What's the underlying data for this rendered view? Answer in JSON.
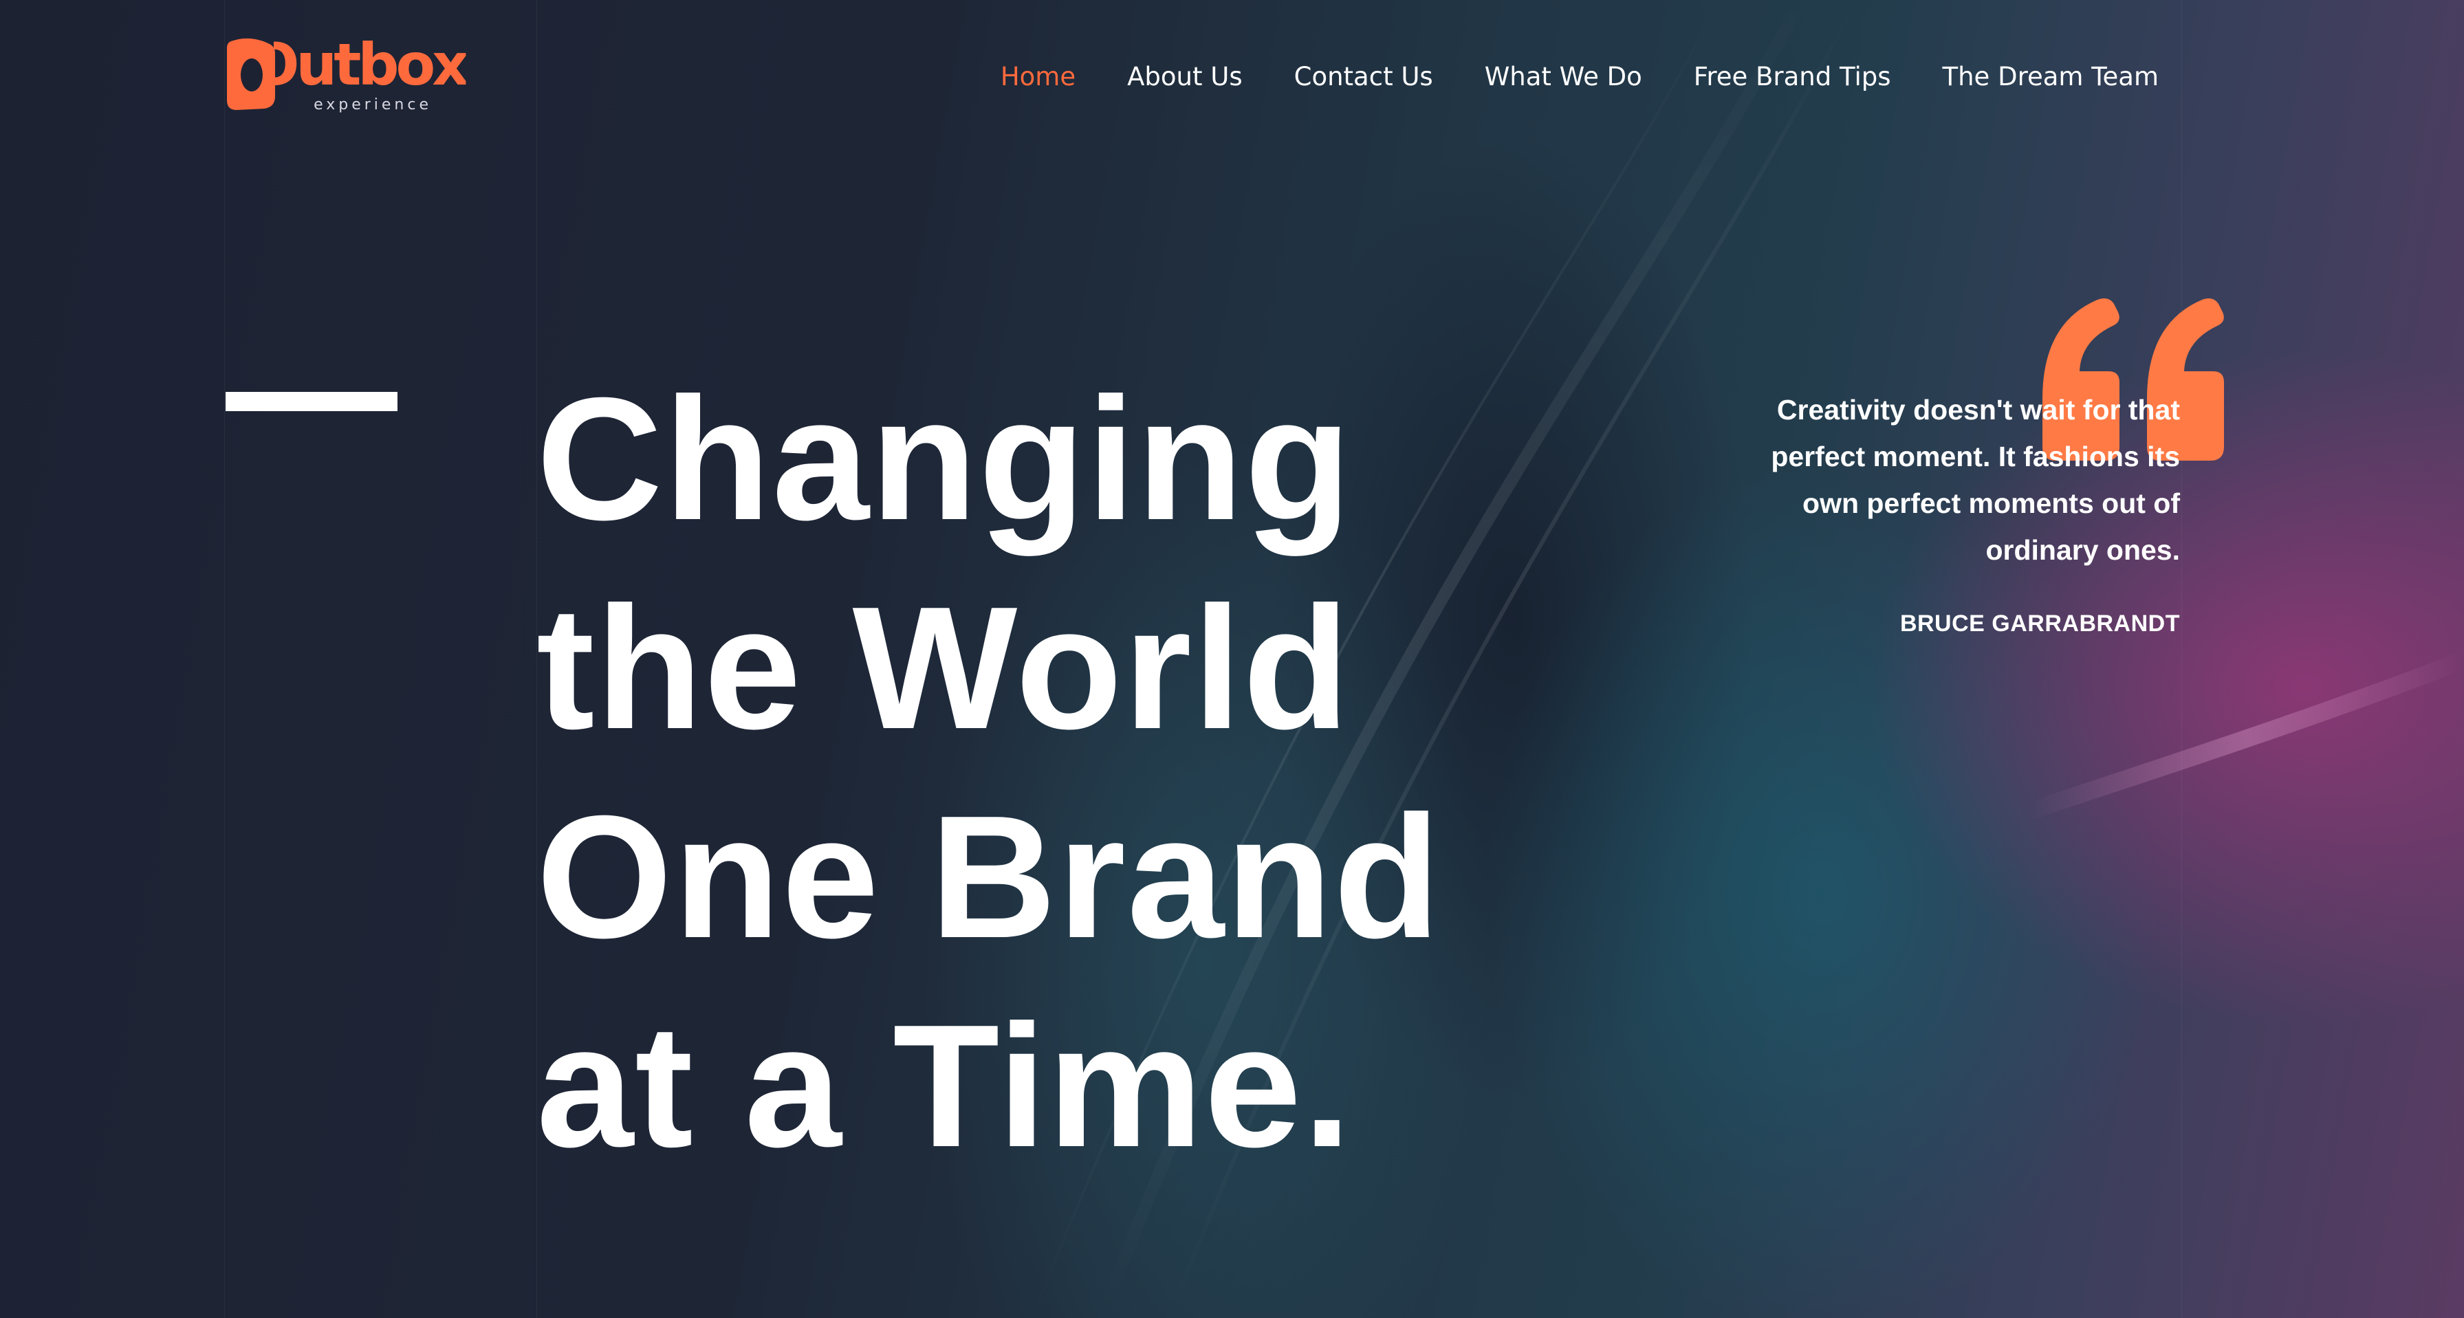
{
  "brand": {
    "name": "Outbox",
    "tagline": "experience",
    "accent_color": "#ff6a3d"
  },
  "nav": {
    "items": [
      {
        "label": "Home",
        "active": true
      },
      {
        "label": "About Us",
        "active": false
      },
      {
        "label": "Contact Us",
        "active": false
      },
      {
        "label": "What We Do",
        "active": false
      },
      {
        "label": "Free Brand Tips",
        "active": false
      },
      {
        "label": "The Dream Team",
        "active": false
      }
    ]
  },
  "hero": {
    "headline_lines": [
      "Changing",
      "the World",
      "One Brand",
      "at a Time."
    ]
  },
  "quote": {
    "icon": "quote-mark-icon",
    "text": "Creativity doesn't wait for that perfect moment. It fashions its own perfect moments out of ordinary ones.",
    "author": "BRUCE GARRABRANDT"
  }
}
